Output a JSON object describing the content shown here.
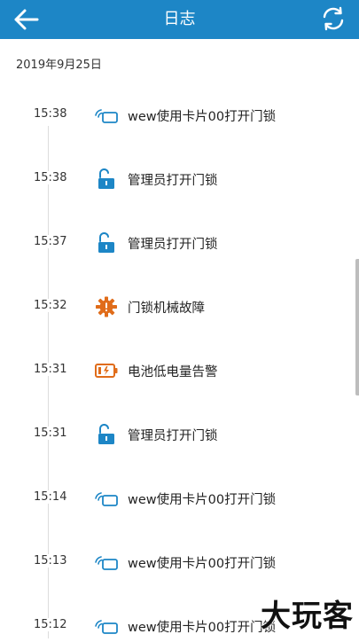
{
  "header": {
    "title": "日志",
    "back_icon": "back-arrow-icon",
    "refresh_icon": "refresh-icon",
    "background": "#1d86c6"
  },
  "date": "2019年9月25日",
  "logs": [
    {
      "time": "15:38",
      "text": "wew使用卡片00打开门锁",
      "icon": "card-icon"
    },
    {
      "time": "15:38",
      "text": "管理员打开门锁",
      "icon": "unlock-icon"
    },
    {
      "time": "15:37",
      "text": "管理员打开门锁",
      "icon": "unlock-icon"
    },
    {
      "time": "15:32",
      "text": "门锁机械故障",
      "icon": "gear-warning-icon"
    },
    {
      "time": "15:31",
      "text": "电池低电量告警",
      "icon": "low-battery-icon"
    },
    {
      "time": "15:31",
      "text": "管理员打开门锁",
      "icon": "unlock-icon"
    },
    {
      "time": "15:14",
      "text": "wew使用卡片00打开门锁",
      "icon": "card-icon"
    },
    {
      "time": "15:13",
      "text": "wew使用卡片00打开门锁",
      "icon": "card-icon"
    },
    {
      "time": "15:12",
      "text": "wew使用卡片00打开门锁",
      "icon": "card-icon"
    }
  ],
  "colors": {
    "blue": "#1d86c6",
    "orange": "#e06c1a"
  },
  "watermark": "大玩客"
}
